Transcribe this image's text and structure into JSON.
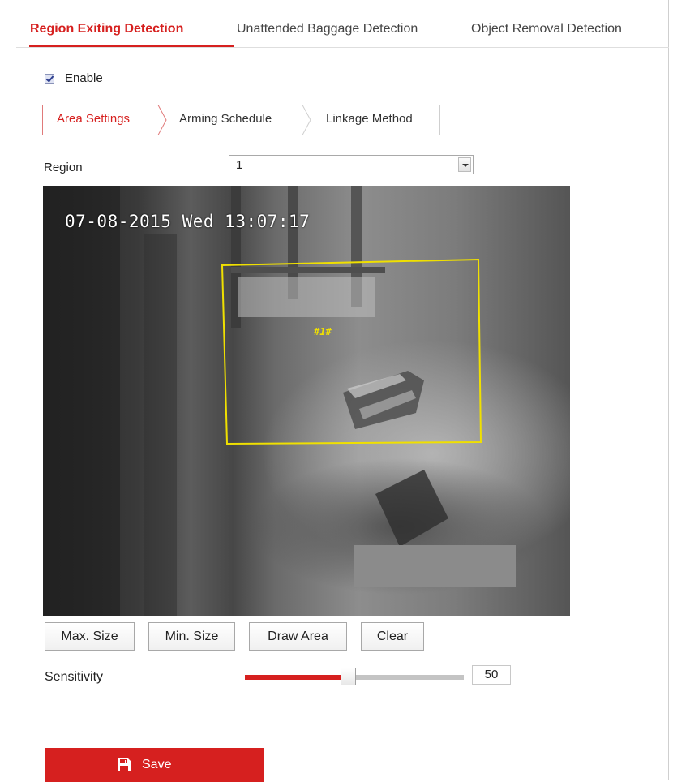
{
  "top_tabs": [
    {
      "label": "Region Exiting Detection",
      "active": true
    },
    {
      "label": "Unattended Baggage Detection",
      "active": false
    },
    {
      "label": "Object Removal Detection",
      "active": false
    }
  ],
  "enable": {
    "label": "Enable",
    "checked": true
  },
  "sub_tabs": [
    {
      "label": "Area Settings",
      "active": true
    },
    {
      "label": "Arming Schedule",
      "active": false
    },
    {
      "label": "Linkage Method",
      "active": false
    }
  ],
  "region": {
    "label": "Region",
    "value": "1"
  },
  "video": {
    "osd_date": "07-08-2015 Wed",
    "osd_time": "13:07:17",
    "area_label": "#1#"
  },
  "buttons": {
    "max_size": "Max. Size",
    "min_size": "Min. Size",
    "draw_area": "Draw Area",
    "clear": "Clear"
  },
  "sensitivity": {
    "label": "Sensitivity",
    "value": "50",
    "level_percent": 50
  },
  "save": {
    "label": "Save",
    "icon": "save-icon"
  },
  "colors": {
    "accent": "#d6201f",
    "area_outline": "#f0e000"
  }
}
